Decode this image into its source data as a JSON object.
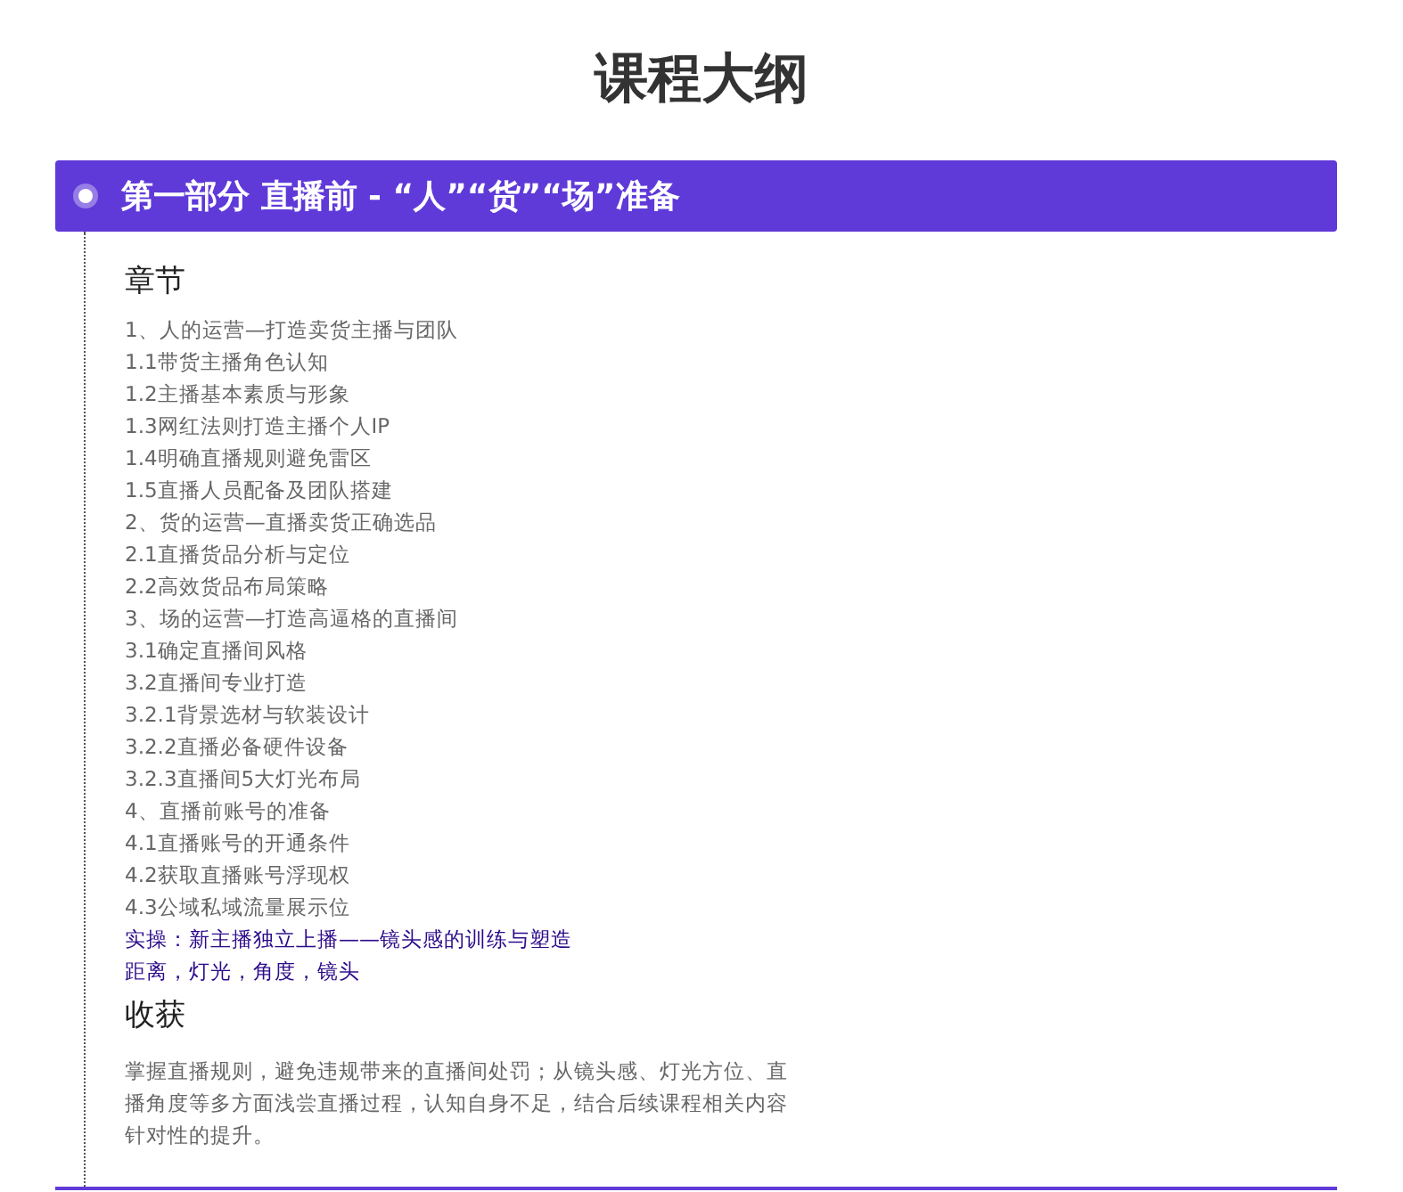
{
  "title": "课程大纲",
  "section": {
    "heading": "第一部分 直播前 - “人”“货”“场”准备",
    "chapters_label": "章节",
    "chapters": [
      {
        "text": "1、人的运营—打造卖货主播与团队",
        "kind": "normal"
      },
      {
        "text": "1.1带货主播角色认知",
        "kind": "normal"
      },
      {
        "text": "1.2主播基本素质与形象",
        "kind": "normal"
      },
      {
        "text": "1.3网红法则打造主播个人IP",
        "kind": "normal"
      },
      {
        "text": "1.4明确直播规则避免雷区",
        "kind": "normal"
      },
      {
        "text": "1.5直播人员配备及团队搭建",
        "kind": "normal"
      },
      {
        "text": "2、货的运营—直播卖货正确选品",
        "kind": "normal"
      },
      {
        "text": "2.1直播货品分析与定位",
        "kind": "normal"
      },
      {
        "text": "2.2高效货品布局策略",
        "kind": "normal"
      },
      {
        "text": "3、场的运营—打造高逼格的直播间",
        "kind": "normal"
      },
      {
        "text": "3.1确定直播间风格",
        "kind": "normal"
      },
      {
        "text": "3.2直播间专业打造",
        "kind": "normal"
      },
      {
        "text": "3.2.1背景选材与软装设计",
        "kind": "normal"
      },
      {
        "text": "3.2.2直播必备硬件设备",
        "kind": "normal"
      },
      {
        "text": "3.2.3直播间5大灯光布局",
        "kind": "normal"
      },
      {
        "text": "4、直播前账号的准备",
        "kind": "normal"
      },
      {
        "text": "4.1直播账号的开通条件",
        "kind": "normal"
      },
      {
        "text": "4.2获取直播账号浮现权",
        "kind": "normal"
      },
      {
        "text": "4.3公域私域流量展示位",
        "kind": "normal"
      },
      {
        "text": "实操：新主播独立上播——镜头感的训练与塑造",
        "kind": "practice"
      },
      {
        "text": "距离，灯光，角度，镜头",
        "kind": "practice"
      }
    ],
    "harvest_label": "收获",
    "harvest_text": "掌握直播规则，避免违规带来的直播间处罚；从镜头感、灯光方位、直播角度等多方面浅尝直播过程，认知自身不足，结合后续课程相关内容针对性的提升。"
  }
}
